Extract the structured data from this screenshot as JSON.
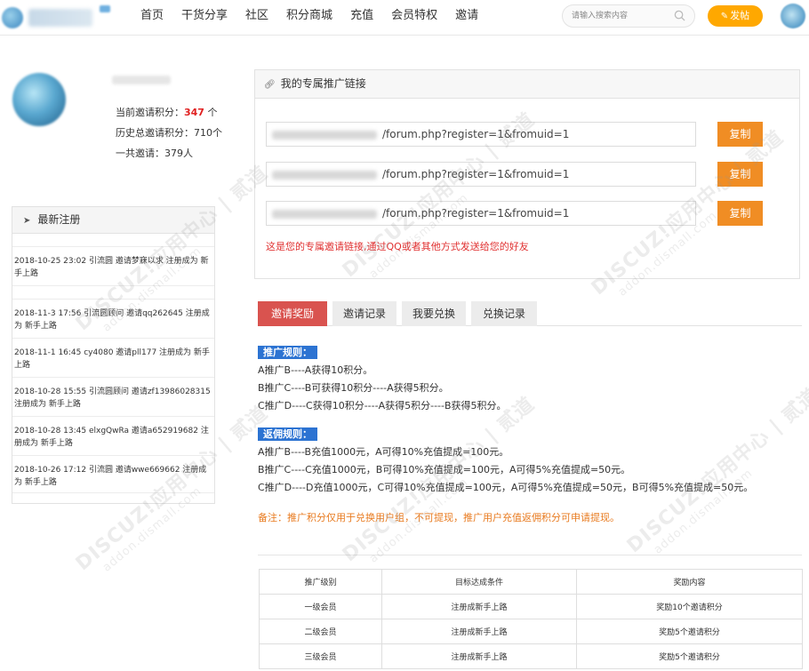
{
  "header": {
    "nav": [
      "首页",
      "干货分享",
      "社区",
      "积分商城",
      "充值",
      "会员特权",
      "邀请"
    ],
    "search_placeholder": "请输入搜索内容",
    "post_label": "发帖"
  },
  "profile": {
    "stats": [
      {
        "label": "当前邀请积分：",
        "value": "347",
        "unit": " 个"
      },
      {
        "label": "历史总邀请积分：",
        "value": "710",
        "unit": "个"
      },
      {
        "label": "一共邀请：",
        "value": "379",
        "unit": "人"
      }
    ]
  },
  "recent": {
    "title": "最新注册",
    "items": [
      "2018-10-25 23:02 引流圆 邀请梦寐以求 注册成为 新手上路",
      "2018-11-3 17:56 引流圆顾问 邀请qq262645 注册成为 新手上路",
      "2018-11-1 16:45 cy4080 邀请pll177 注册成为 新手上路",
      "2018-10-28 15:55 引流圆顾问 邀请zf13986028315 注册成为 新手上路",
      "2018-10-28 13:45 elxgQwRa 邀请a652919682 注册成为 新手上路",
      "2018-10-26 17:12 引流圆 邀请wwe669662 注册成为 新手上路"
    ]
  },
  "promo": {
    "title": "我的专属推广链接",
    "links": [
      "/forum.php?register=1&fromuid=1",
      "/forum.php?register=1&fromuid=1",
      "/forum.php?register=1&fromuid=1"
    ],
    "copy_label": "复制",
    "note": "这是您的专属邀请链接,通过QQ或者其他方式发送给您的好友"
  },
  "tabs": [
    "邀请奖励",
    "邀请记录",
    "我要兑换",
    "兑换记录"
  ],
  "rules": {
    "promo_title": "推广规则：",
    "promo_lines": [
      "A推广B----A获得10积分。",
      "B推广C----B可获得10积分----A获得5积分。",
      "C推广D----C获得10积分----A获得5积分----B获得5积分。"
    ],
    "rebate_title": "返佣规则：",
    "rebate_lines": [
      "A推广B----B充值1000元，A可得10%充值提成=100元。",
      "B推广C----C充值1000元，B可得10%充值提成=100元，A可得5%充值提成=50元。",
      "C推广D----D充值1000元，C可得10%充值提成=100元，A可得5%充值提成=50元，B可得5%充值提成=50元。"
    ],
    "note": "备注：推广积分仅用于兑换用户组，不可提现，推广用户充值返佣积分可申请提现。"
  },
  "table": {
    "headers": [
      "推广级别",
      "目标达成条件",
      "奖励内容"
    ],
    "rows": [
      [
        "一级会员",
        "注册成新手上路",
        "奖励10个邀请积分"
      ],
      [
        "二级会员",
        "注册成新手上路",
        "奖励5个邀请积分"
      ],
      [
        "三级会员",
        "注册成新手上路",
        "奖励5个邀请积分"
      ]
    ]
  },
  "watermark": {
    "line1": "DISCUZ!应用中心 | 贰道",
    "line2": "addon.dismall.com"
  },
  "colors": {
    "accent_red": "#d9534f",
    "copy_orange": "#f08d24",
    "post_yellow": "#ffa800",
    "rule_blue": "#2c73d2",
    "note_red": "#e03030",
    "note_orange": "#e87b20"
  }
}
